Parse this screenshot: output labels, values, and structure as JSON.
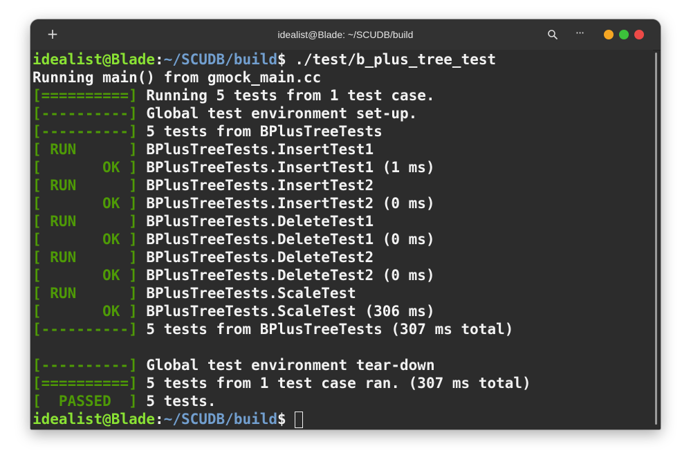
{
  "window": {
    "title": "idealist@Blade: ~/SCUDB/build",
    "new_tab_icon": "plus-icon",
    "search_icon": "search-icon",
    "menu_icon": "ellipsis-icon",
    "controls": [
      "minimize",
      "maximize",
      "close"
    ]
  },
  "colors": {
    "terminal_bg": "#2c2c2c",
    "gtest_green": "#4e9a06",
    "prompt_user": "#8ae234",
    "prompt_path": "#729fcf",
    "text": "#f2f2f2"
  },
  "terminal": {
    "prompt1": {
      "user": "idealist@Blade",
      "sep": ":",
      "path": "~/SCUDB/build",
      "sym": "$",
      "cmd": " ./test/b_plus_tree_test"
    },
    "lines": [
      {
        "tag": "",
        "text": "Running main() from gmock_main.cc"
      },
      {
        "tag": "[==========]",
        "text": " Running 5 tests from 1 test case."
      },
      {
        "tag": "[----------]",
        "text": " Global test environment set-up."
      },
      {
        "tag": "[----------]",
        "text": " 5 tests from BPlusTreeTests"
      },
      {
        "tag": "[ RUN      ]",
        "text": " BPlusTreeTests.InsertTest1"
      },
      {
        "tag": "[       OK ]",
        "text": " BPlusTreeTests.InsertTest1 (1 ms)"
      },
      {
        "tag": "[ RUN      ]",
        "text": " BPlusTreeTests.InsertTest2"
      },
      {
        "tag": "[       OK ]",
        "text": " BPlusTreeTests.InsertTest2 (0 ms)"
      },
      {
        "tag": "[ RUN      ]",
        "text": " BPlusTreeTests.DeleteTest1"
      },
      {
        "tag": "[       OK ]",
        "text": " BPlusTreeTests.DeleteTest1 (0 ms)"
      },
      {
        "tag": "[ RUN      ]",
        "text": " BPlusTreeTests.DeleteTest2"
      },
      {
        "tag": "[       OK ]",
        "text": " BPlusTreeTests.DeleteTest2 (0 ms)"
      },
      {
        "tag": "[ RUN      ]",
        "text": " BPlusTreeTests.ScaleTest"
      },
      {
        "tag": "[       OK ]",
        "text": " BPlusTreeTests.ScaleTest (306 ms)"
      },
      {
        "tag": "[----------]",
        "text": " 5 tests from BPlusTreeTests (307 ms total)"
      },
      {
        "tag": "",
        "text": ""
      },
      {
        "tag": "[----------]",
        "text": " Global test environment tear-down"
      },
      {
        "tag": "[==========]",
        "text": " 5 tests from 1 test case ran. (307 ms total)"
      },
      {
        "tag": "[  PASSED  ]",
        "text": " 5 tests."
      }
    ],
    "prompt2": {
      "user": "idealist@Blade",
      "sep": ":",
      "path": "~/SCUDB/build",
      "sym": "$",
      "cmd": " "
    }
  }
}
